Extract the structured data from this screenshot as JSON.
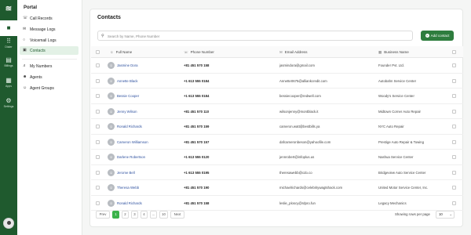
{
  "rail": {
    "items": [
      {
        "label": "",
        "icon": "phone-icon"
      },
      {
        "label": "Dialer",
        "icon": "grid-icon"
      },
      {
        "label": "Billings",
        "icon": "billing-icon"
      },
      {
        "label": "Apps",
        "icon": "apps-icon"
      },
      {
        "label": "Settings",
        "icon": "gear-icon"
      }
    ]
  },
  "sidebar": {
    "title": "Portal",
    "items": [
      {
        "label": "Call Records",
        "icon": "call-records-icon"
      },
      {
        "label": "Message Logs",
        "icon": "message-icon"
      },
      {
        "label": "Voicemail Logs",
        "icon": "voicemail-icon"
      },
      {
        "label": "Contacts",
        "icon": "contacts-icon"
      },
      {
        "label": "My Numbers",
        "icon": "numbers-icon"
      },
      {
        "label": "Agents",
        "icon": "agent-icon"
      },
      {
        "label": "Agent Groups",
        "icon": "agent-groups-icon"
      }
    ]
  },
  "main": {
    "title": "Contacts",
    "search_placeholder": "Search by Name, Phone Number",
    "add_button": "Add contact",
    "columns": [
      "Full Name",
      "Phone Number",
      "Email Address",
      "Business Name"
    ],
    "rows": [
      {
        "name": "Jasmine Dora",
        "phone": "+81 451 570 158",
        "email": "jasmindora@gmail.com",
        "business": "Founder Pvt. Ltd."
      },
      {
        "name": "Annette Black",
        "phone": "+1 613 555 0184",
        "email": "Annette0675@alliankcredit.com",
        "business": "Autobahn Service Center"
      },
      {
        "name": "Bessie Cooper",
        "phone": "+1 613 555 0184",
        "email": "bessiecooper@redwell.com",
        "business": "Woody's Service Center"
      },
      {
        "name": "Jenny Wilson",
        "phone": "+81 451 570 110",
        "email": "wilsonjenny@montblack.it",
        "business": "Midtown Corner Auto Repair"
      },
      {
        "name": "Ronald Richards",
        "phone": "+81 451 570 159",
        "email": "cameron.watt@bestbills.ya",
        "business": "NYC Auto Repair"
      },
      {
        "name": "Cameron Williamson",
        "phone": "+81 451 570 157",
        "email": "dafcameronbeson@yahoofile.com",
        "business": "Prestige Auto Repair & Towing"
      },
      {
        "name": "Darlene Robertson",
        "phone": "+1 613 555 0120",
        "email": "jennrobert@infoplus.us",
        "business": "Nashua Service Center"
      },
      {
        "name": "Jerome Bell",
        "phone": "+1 613 555 0195",
        "email": "theresawebb@cdo.co",
        "business": "Bridgeview Auto Service Center"
      },
      {
        "name": "Theresa Webb",
        "phone": "+81 451 570 190",
        "email": "michaelrichards@celebritywagtshack.com",
        "business": "United Motor Service Center, Inc."
      },
      {
        "name": "Ronald Richards",
        "phone": "+81 451 570 158",
        "email": "leslie_ploscy@rdpro.fun",
        "business": "Legacy Mechanics"
      }
    ]
  },
  "pagination": {
    "prev": "Prev",
    "pages": [
      "1",
      "2",
      "3",
      "4",
      "...",
      "10"
    ],
    "active_page": "1",
    "next": "Next",
    "rows_label": "Showing rows per page",
    "rows_value": "10"
  },
  "colors": {
    "brand": "#1f5a2e",
    "accent": "#3bb24b",
    "link": "#2c4f9e"
  }
}
